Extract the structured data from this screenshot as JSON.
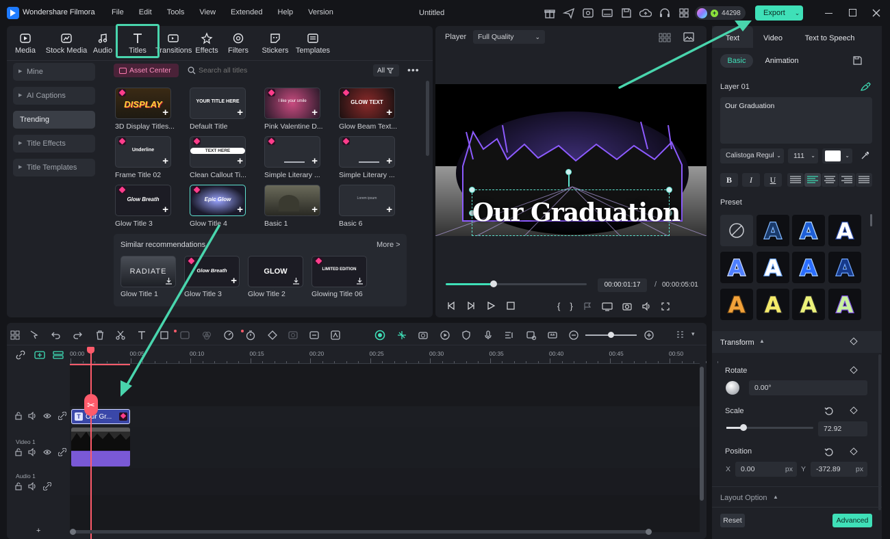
{
  "app": {
    "name": "Wondershare Filmora",
    "doc_title": "Untitled",
    "credits": "44298",
    "export_label": "Export"
  },
  "menu": [
    "File",
    "Edit",
    "Tools",
    "View",
    "Extended",
    "Help",
    "Version"
  ],
  "media_tabs": [
    {
      "label": "Media",
      "icon": "media-icon"
    },
    {
      "label": "Stock Media",
      "icon": "stock-media-icon"
    },
    {
      "label": "Audio",
      "icon": "audio-icon"
    },
    {
      "label": "Titles",
      "icon": "titles-icon",
      "active": true
    },
    {
      "label": "Transitions",
      "icon": "transitions-icon"
    },
    {
      "label": "Effects",
      "icon": "effects-icon"
    },
    {
      "label": "Filters",
      "icon": "filters-icon"
    },
    {
      "label": "Stickers",
      "icon": "stickers-icon"
    },
    {
      "label": "Templates",
      "icon": "templates-icon"
    }
  ],
  "sidebar": [
    {
      "label": "Mine",
      "expandable": true
    },
    {
      "label": "AI Captions",
      "expandable": true
    },
    {
      "label": "Trending",
      "expandable": false,
      "active": true
    },
    {
      "label": "Title Effects",
      "expandable": true
    },
    {
      "label": "Title Templates",
      "expandable": true
    }
  ],
  "asset_center": "Asset Center",
  "search_placeholder": "Search all titles",
  "filter_label": "All",
  "titles_grid": [
    {
      "name": "3D Display Titles...",
      "thumb": "DISPLAY"
    },
    {
      "name": "Default Title",
      "thumb": "YOUR TITLE HERE"
    },
    {
      "name": "Pink Valentine D...",
      "thumb": "I like your smile"
    },
    {
      "name": "Glow Beam Text...",
      "thumb": "GLOW TEXT"
    },
    {
      "name": "Frame Title 02",
      "thumb": "Underline"
    },
    {
      "name": "Clean Callout Ti...",
      "thumb": "TEXT HERE"
    },
    {
      "name": "Simple Literary ...",
      "thumb": ""
    },
    {
      "name": "Simple Literary ...",
      "thumb": ""
    },
    {
      "name": "Glow Title 3",
      "thumb": "Glow Breath"
    },
    {
      "name": "Glow Title 4",
      "thumb": "Epic Glow"
    },
    {
      "name": "Basic 1",
      "thumb": ""
    },
    {
      "name": "Basic 6",
      "thumb": "Lorem ipsum"
    }
  ],
  "similar": {
    "heading": "Similar recommendations",
    "more": "More >",
    "items": [
      {
        "name": "Glow Title 1",
        "thumb": "RADIATE"
      },
      {
        "name": "Glow Title 3",
        "thumb": "Glow Breath"
      },
      {
        "name": "Glow Title 2",
        "thumb": "GLOW"
      },
      {
        "name": "Glowing Title 06",
        "thumb": "LIMITED EDITION"
      }
    ]
  },
  "player": {
    "label": "Player",
    "quality": "Full Quality",
    "overlay_text": "Our Graduation",
    "current_time": "00:00:01:17",
    "total_time": "00:00:05:01",
    "separator": "/",
    "progress": 0.34
  },
  "right_panel": {
    "tabs": [
      "Text",
      "Video",
      "Text to Speech"
    ],
    "subtabs": [
      "Basic",
      "Animation"
    ],
    "layer": "Layer 01",
    "text_value": "Our Graduation",
    "font": "Calistoga Regul",
    "font_size": "111",
    "align_buttons": [
      "B",
      "I",
      "U"
    ],
    "preset_label": "Preset",
    "transform_label": "Transform",
    "rotate": {
      "label": "Rotate",
      "value": "0.00°"
    },
    "scale": {
      "label": "Scale",
      "value": "72.92",
      "fraction": 0.2
    },
    "position": {
      "label": "Position",
      "x_label": "X",
      "x": "0.00",
      "y_label": "Y",
      "y": "-372.89",
      "unit": "px"
    },
    "layout_option": "Layout Option",
    "reset": "Reset",
    "advanced": "Advanced"
  },
  "timeline": {
    "ruler": [
      "00:00",
      "00:05",
      "00:10",
      "00:15",
      "00:20",
      "00:25",
      "00:30",
      "00:35",
      "00:40",
      "00:45",
      "00:50"
    ],
    "tracks": [
      {
        "label": ""
      },
      {
        "label": "Video 1"
      },
      {
        "label": "Audio 1"
      }
    ],
    "title_clip": "Our Gr...",
    "add": "+"
  },
  "colors": {
    "accent": "#3fe0b8",
    "bg": "#1f2127",
    "arrow": "#49d5ad",
    "playhead": "#ff5b6b",
    "title_clip": "#3a47a8",
    "video_clip": "#6c4bc9"
  }
}
